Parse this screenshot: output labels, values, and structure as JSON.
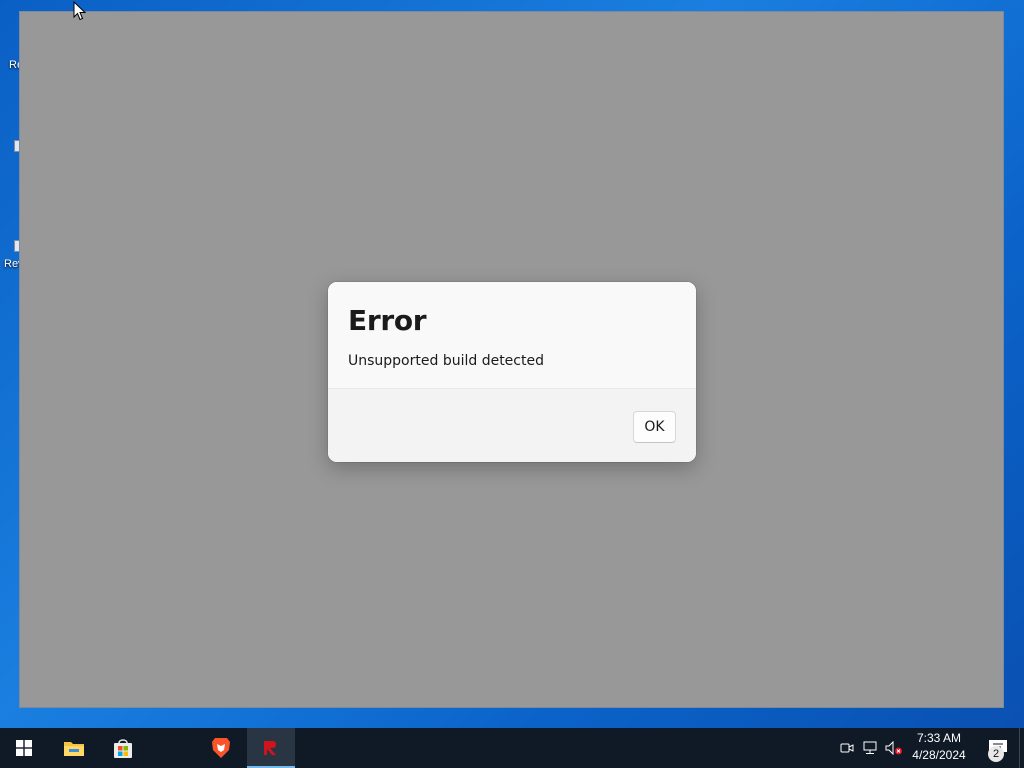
{
  "desktop": {
    "icons": [
      {
        "label": "Re"
      },
      {
        "label": ""
      },
      {
        "label": "Rev"
      }
    ]
  },
  "dialog": {
    "title": "Error",
    "message": "Unsupported build detected",
    "ok_label": "OK"
  },
  "taskbar": {
    "items": [
      {
        "name": "start",
        "icon": "windows-logo-icon"
      },
      {
        "name": "file-explorer",
        "icon": "folder-icon"
      },
      {
        "name": "microsoft-store",
        "icon": "store-bag-icon"
      },
      {
        "name": "brave-browser",
        "icon": "brave-lion-icon"
      },
      {
        "name": "active-app",
        "icon": "red-app-icon",
        "active": true
      }
    ],
    "tray": {
      "time": "7:33 AM",
      "date": "4/28/2024",
      "notification_count": "2"
    }
  },
  "colors": {
    "desktop_blue": "#1a7fe0",
    "window_gray": "#989898",
    "taskbar": "#101a26",
    "active_indicator": "#76b9ed"
  }
}
